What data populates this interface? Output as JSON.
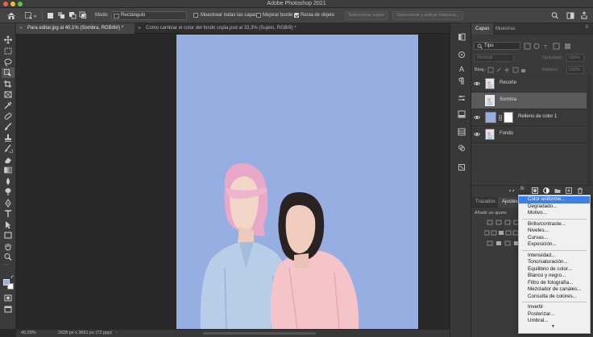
{
  "app": {
    "title": "Adobe Photoshop 2021"
  },
  "options_bar": {
    "mode_label": "Modo:",
    "mode_value": "Rectángulo",
    "sample_all_layers": "Muestrear todas las capas",
    "enhance_edge": "Mejorar borde",
    "object_subtract": "Resta de objeto",
    "select_subject": "Seleccionar sujeto",
    "select_and_mask": "Seleccionar y aplicar máscara...",
    "checks": {
      "sample_all_layers": false,
      "enhance_edge": false,
      "object_subtract": true
    }
  },
  "tabs": [
    {
      "label": "Para editar.jpg al 40,1% (Sombra, RGB/8#) *",
      "active": true
    },
    {
      "label": "Como cambiar el color del fondo copia.psd al 33,3% (Sujeto, RGB/8) *",
      "active": false
    }
  ],
  "status": {
    "zoom": "40,09%",
    "doc_info": "2928 px x 3661 px (72 ppp)"
  },
  "layers_panel": {
    "tabs": [
      "Capas",
      "Muestras"
    ],
    "filter": "Tipo",
    "blend_mode": "Normal",
    "opacity_label": "Opacidad:",
    "opacity_value": "100%",
    "lock_label": "Bloq.:",
    "fill_label": "Relleno:",
    "fill_value": "100%",
    "layers": [
      {
        "name": "Recorte",
        "visible": true,
        "selected": false
      },
      {
        "name": "Sombra",
        "visible": false,
        "selected": true
      },
      {
        "name": "Relleno de color 1",
        "visible": true,
        "selected": false
      },
      {
        "name": "Fondo",
        "visible": true,
        "selected": false
      }
    ]
  },
  "adjust_panel": {
    "tabs": [
      "Trazados",
      "Ajustes"
    ],
    "subtitle": "Añadir un ajuste"
  },
  "menu": {
    "items": [
      {
        "label": "Color uniforme...",
        "highlighted": true
      },
      {
        "label": "Degradado..."
      },
      {
        "label": "Motivo..."
      },
      {
        "sep": true
      },
      {
        "label": "Brillo/contraste..."
      },
      {
        "label": "Niveles..."
      },
      {
        "label": "Curvas..."
      },
      {
        "label": "Exposición..."
      },
      {
        "sep": true
      },
      {
        "label": "Intensidad..."
      },
      {
        "label": "Tono/saturación..."
      },
      {
        "label": "Equilibrio de color..."
      },
      {
        "label": "Blanco y negro..."
      },
      {
        "label": "Filtro de fotografía..."
      },
      {
        "label": "Mezclador de canales..."
      },
      {
        "label": "Consulta de colores..."
      },
      {
        "sep": true
      },
      {
        "label": "Invertir"
      },
      {
        "label": "Posterizar..."
      },
      {
        "label": "Umbral..."
      }
    ]
  },
  "colors": {
    "canvas_bg": "#97aee3",
    "menu_highlight": "#3f7fe6",
    "traffic_close": "#ee5f57",
    "traffic_min": "#f5bd2e",
    "traffic_max": "#5fc73f"
  }
}
